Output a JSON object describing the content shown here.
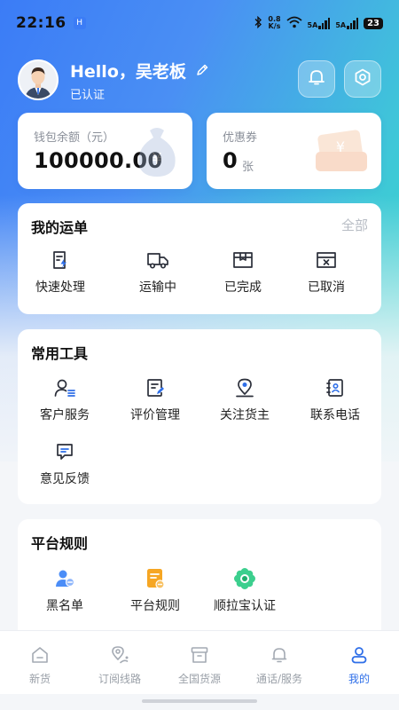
{
  "status_bar": {
    "time": "22:16",
    "app_badge": "H",
    "net_speed_top": "0.8",
    "net_speed_bottom": "K/s",
    "signal1": "5A",
    "signal2": "5A",
    "battery": "23"
  },
  "profile": {
    "greeting": "Hello，吴老板",
    "status": "已认证",
    "icons": {
      "avatar": "person-avatar",
      "edit": "pencil-icon",
      "bell": "bell-icon",
      "settings": "hexagon-settings-icon"
    }
  },
  "wallet": {
    "label": "钱包余额（元）",
    "amount": "100000.00"
  },
  "coupon": {
    "label": "优惠券",
    "count": "0",
    "unit": "张"
  },
  "orders": {
    "title": "我的运单",
    "all_link": "全部",
    "items": [
      {
        "label": "快速处理",
        "icon": "quick-process-icon"
      },
      {
        "label": "运输中",
        "icon": "truck-icon"
      },
      {
        "label": "已完成",
        "icon": "box-complete-icon"
      },
      {
        "label": "已取消",
        "icon": "box-cancel-icon"
      }
    ]
  },
  "tools": {
    "title": "常用工具",
    "items": [
      {
        "label": "客户服务",
        "icon": "customer-service-icon"
      },
      {
        "label": "评价管理",
        "icon": "review-manage-icon"
      },
      {
        "label": "关注货主",
        "icon": "location-pin-icon"
      },
      {
        "label": "联系电话",
        "icon": "contact-book-icon"
      },
      {
        "label": "意见反馈",
        "icon": "feedback-icon"
      }
    ]
  },
  "rules": {
    "title": "平台规则",
    "items": [
      {
        "label": "黑名单",
        "icon": "blacklist-user-icon"
      },
      {
        "label": "平台规则",
        "icon": "rules-document-icon"
      },
      {
        "label": "顺拉宝认证",
        "icon": "certification-flower-icon"
      }
    ]
  },
  "nav": {
    "items": [
      {
        "label": "新货",
        "icon": "home-icon",
        "active": false
      },
      {
        "label": "订阅线路",
        "icon": "route-pin-icon",
        "active": false
      },
      {
        "label": "全国货源",
        "icon": "archive-box-icon",
        "active": false
      },
      {
        "label": "通话/服务",
        "icon": "bell-icon",
        "active": false
      },
      {
        "label": "我的",
        "icon": "user-icon",
        "active": true
      }
    ]
  },
  "colors": {
    "accent": "#2f6fe8",
    "gradient_start": "#3b7cf6",
    "gradient_end": "#34dcc6"
  }
}
